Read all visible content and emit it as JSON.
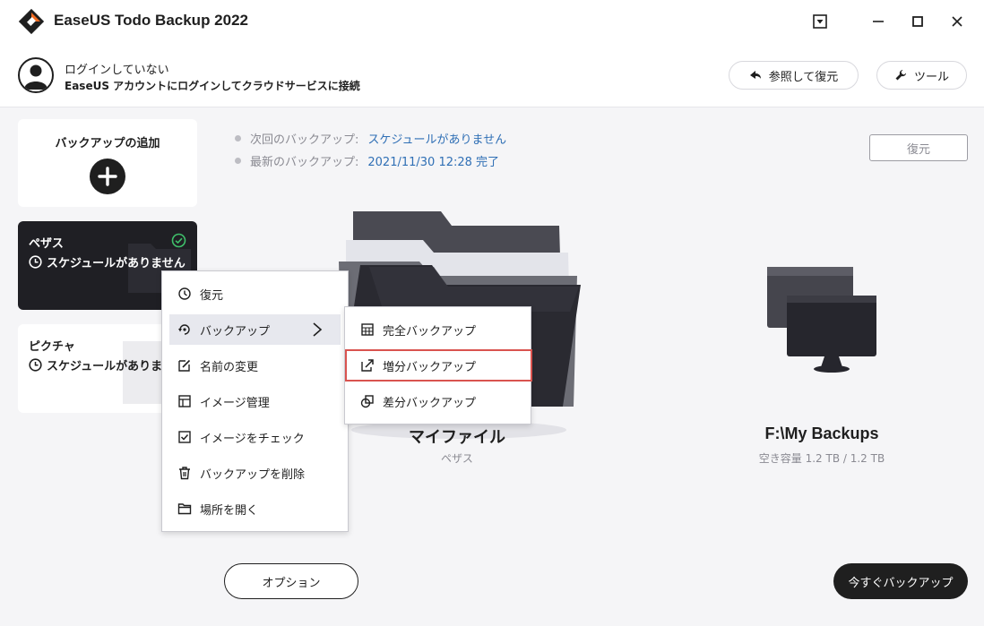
{
  "app": {
    "title": "EaseUS Todo Backup 2022"
  },
  "account": {
    "status": "ログインしていない",
    "description": "EaseUS アカウントにログインしてクラウドサービスに接続",
    "browse_restore_label": "参照して復元",
    "tools_label": "ツール"
  },
  "sidebar": {
    "add_backup_label": "バックアップの追加",
    "tasks": [
      {
        "name": "ペザス",
        "schedule": "スケジュールがありません"
      },
      {
        "name": "ピクチャ",
        "schedule": "スケジュールがありません"
      }
    ]
  },
  "info": {
    "next_label": "次回のバックアップ:",
    "next_value": "スケジュールがありません",
    "last_label": "最新のバックアップ:",
    "last_value": "2021/11/30 12:28 完了",
    "restore_label": "復元"
  },
  "source": {
    "name": "マイファイル",
    "task": "ペザス"
  },
  "destination": {
    "name": "F:\\My Backups",
    "free_space": "空き容量 1.2 TB / 1.2 TB"
  },
  "context_menu": {
    "items": [
      {
        "label": "復元",
        "icon": "restore-icon"
      },
      {
        "label": "バックアップ",
        "icon": "backup-icon"
      },
      {
        "label": "名前の変更",
        "icon": "edit-icon"
      },
      {
        "label": "イメージ管理",
        "icon": "image-manage-icon"
      },
      {
        "label": "イメージをチェック",
        "icon": "check-icon"
      },
      {
        "label": "バックアップを削除",
        "icon": "trash-icon"
      },
      {
        "label": "場所を開く",
        "icon": "folder-icon"
      }
    ]
  },
  "submenu": {
    "items": [
      {
        "label": "完全バックアップ",
        "icon": "full-backup-icon"
      },
      {
        "label": "増分バックアップ",
        "icon": "incremental-backup-icon"
      },
      {
        "label": "差分バックアップ",
        "icon": "differential-backup-icon"
      }
    ]
  },
  "footer": {
    "options_label": "オプション",
    "backup_now_label": "今すぐバックアップ"
  },
  "colors": {
    "accent": "#2f6fb5",
    "dark": "#1f1f24",
    "highlight": "#d9534f",
    "logo": "#f26b21"
  }
}
